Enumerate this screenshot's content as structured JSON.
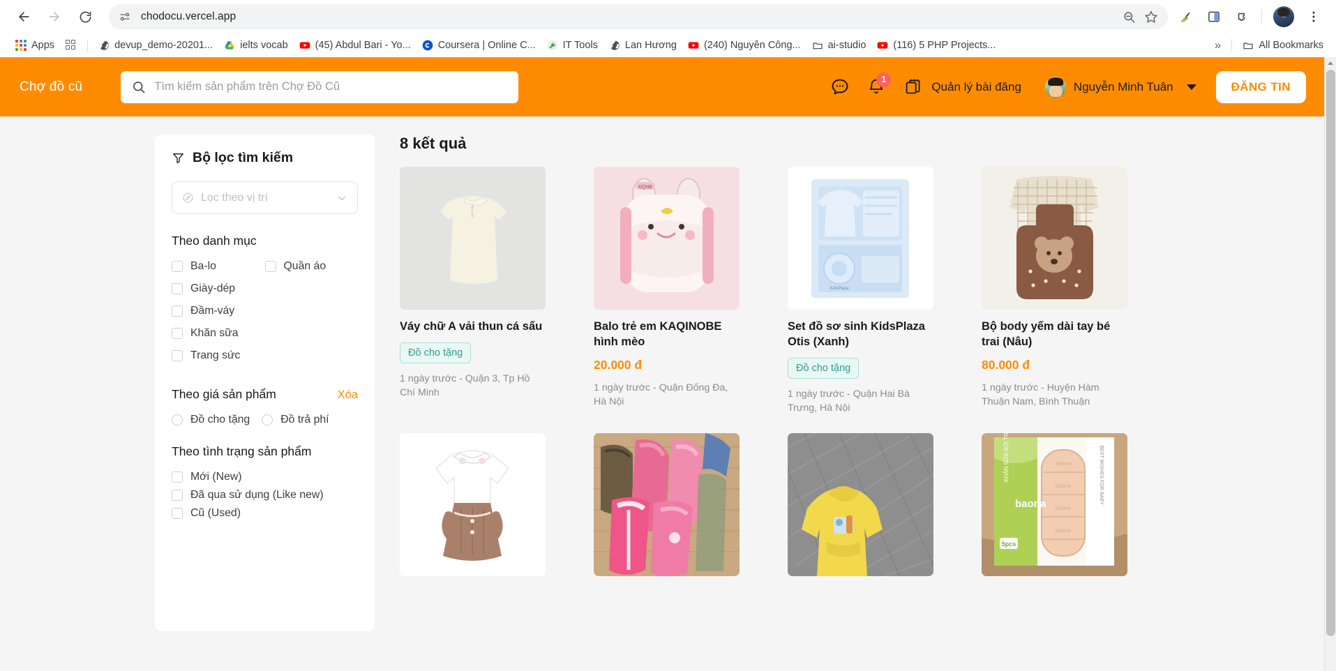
{
  "browser": {
    "url": "chodocu.vercel.app",
    "nav": {
      "back_label": "Back",
      "forward_label": "Forward",
      "reload_label": "Reload"
    },
    "omnibox_icons": [
      "site-info-icon",
      "zoom-icon",
      "bookmark-star-icon"
    ],
    "toolbar_icons": [
      "extension-colorful-icon",
      "side-panel-icon",
      "extensions-puzzle-icon",
      "profile-avatar",
      "chrome-menu-icon"
    ],
    "bookmarks": [
      {
        "label": "Apps",
        "icon": "apps-grid-icon"
      },
      {
        "label": "",
        "icon": "bookmark-grid-icon"
      },
      {
        "label": "devup_demo-20201...",
        "icon": "globe-icon"
      },
      {
        "label": "ielts vocab",
        "icon": "google-drive-icon"
      },
      {
        "label": "(45) Abdul Bari - Yo...",
        "icon": "youtube-icon"
      },
      {
        "label": "Coursera | Online C...",
        "icon": "coursera-icon"
      },
      {
        "label": "IT Tools",
        "icon": "it-tools-icon"
      },
      {
        "label": "Lan Hương",
        "icon": "globe-icon"
      },
      {
        "label": "(240) Nguyễn Công...",
        "icon": "youtube-icon"
      },
      {
        "label": "ai-studio",
        "icon": "folder-icon"
      },
      {
        "label": "(116) 5 PHP Projects...",
        "icon": "youtube-icon"
      }
    ],
    "overflow_label": "»",
    "all_bookmarks_label": "All Bookmarks"
  },
  "site": {
    "brand": "Chợ đồ cũ",
    "search_placeholder": "Tìm kiếm sản phẩm trên Chợ Đồ Cũ",
    "search_value": "",
    "messages_icon": "chat-bubble-icon",
    "notifications_icon": "bell-icon",
    "notifications_count": "1",
    "manage_posts_icon": "documents-icon",
    "manage_posts_label": "Quản lý bài đăng",
    "user_name": "Nguyễn Minh Tuân",
    "post_button": "ĐĂNG TIN",
    "accent_color": "#ff8c00"
  },
  "sidebar": {
    "title": "Bộ lọc tìm kiếm",
    "filter_icon": "funnel-icon",
    "location": {
      "placeholder": "Lọc theo vị trí",
      "icon": "compass-icon",
      "chevron": "chevron-down-icon"
    },
    "category": {
      "title": "Theo danh mục",
      "options": [
        "Ba-lo",
        "Quần áo",
        "Giày-dép",
        "Đầm-váy",
        "Khăn sữa",
        "Trang sức"
      ]
    },
    "price": {
      "title": "Theo giá sản phẩm",
      "clear_label": "Xóa",
      "options": [
        "Đồ cho tặng",
        "Đồ trả phí"
      ]
    },
    "condition": {
      "title": "Theo tình trạng sản phẩm",
      "options": [
        "Mới (New)",
        "Đã qua sử dụng (Like new)",
        "Cũ (Used)"
      ]
    }
  },
  "results": {
    "count_label": "8 kết quả",
    "free_tag": "Đồ cho tặng",
    "items": [
      {
        "title": "Váy chữ A vải thun cá sấu",
        "tag": "Đồ cho tặng",
        "price": "",
        "meta": "1 ngày trước - Quận 3, Tp Hồ Chí Minh",
        "image": "cream-sleeveless-polo-dress"
      },
      {
        "title": "Balo trẻ em KAQINOBE hình mèo",
        "tag": "",
        "price": "20.000 đ",
        "meta": "1 ngày trước - Quận Đống Đa, Hà Nội",
        "image": "pink-cat-backpack"
      },
      {
        "title": "Set đồ sơ sinh KidsPlaza Otis (Xanh)",
        "tag": "Đồ cho tặng",
        "price": "",
        "meta": "1 ngày trước - Quận Hai Bà Trưng, Hà Nội",
        "image": "blue-newborn-set"
      },
      {
        "title": "Bộ body yếm dài tay bé trai (Nâu)",
        "tag": "",
        "price": "80.000 đ",
        "meta": "1 ngày trước - Huyện Hàm Thuận Nam, Bình Thuận",
        "image": "brown-overall-outfit"
      },
      {
        "title": "",
        "tag": "",
        "price": "",
        "meta": "",
        "image": "brown-white-collar-dress"
      },
      {
        "title": "",
        "tag": "",
        "price": "",
        "meta": "",
        "image": "pink-jackets-pile"
      },
      {
        "title": "",
        "tag": "",
        "price": "",
        "meta": "",
        "image": "yellow-hoodie"
      },
      {
        "title": "",
        "tag": "",
        "price": "",
        "meta": "",
        "image": "baona-towel-box"
      }
    ]
  }
}
